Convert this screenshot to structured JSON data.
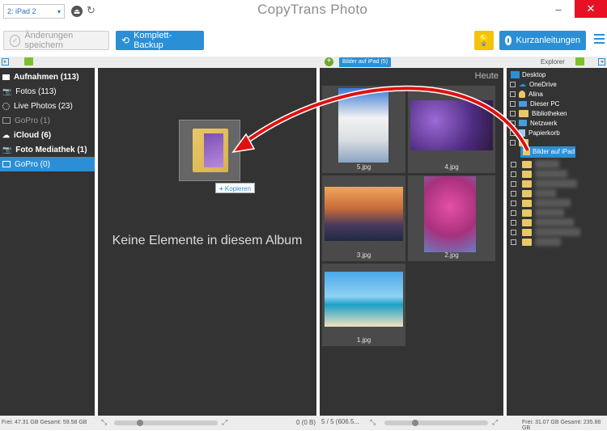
{
  "device": {
    "label": "2: iPad 2"
  },
  "app": {
    "title": "CopyTrans Photo"
  },
  "window": {
    "minimize": "–",
    "close": "✕"
  },
  "toolbar": {
    "save_label": "Änderungen speichern",
    "backup_label": "Komplett-Backup",
    "guides_label": "Kurzanleitungen"
  },
  "sidebar": {
    "items": [
      {
        "label": "Aufnahmen (113)",
        "icon": "folder-icon",
        "bold": true
      },
      {
        "label": "Fotos (113)",
        "icon": "camera-icon"
      },
      {
        "label": "Live Photos (23)",
        "icon": "live-photos-icon"
      },
      {
        "label": "GoPro (1)",
        "icon": "gopro-icon",
        "dim": true
      },
      {
        "label": "iCloud (6)",
        "icon": "cloud-icon",
        "bold": true
      },
      {
        "label": "Foto Mediathek (1)",
        "icon": "camera-icon",
        "bold": true
      },
      {
        "label": "GoPro (0)",
        "icon": "gopro-icon",
        "selected": true
      }
    ]
  },
  "album": {
    "empty_text": "Keine Elemente in diesem Album",
    "drag_tooltip": "Kopieren"
  },
  "pc": {
    "tab_label": "Bilder auf iPad (5)",
    "group_header": "Heute",
    "photos": [
      {
        "name": "5.jpg"
      },
      {
        "name": "4.jpg"
      },
      {
        "name": "3.jpg"
      },
      {
        "name": "2.jpg"
      },
      {
        "name": "1.jpg"
      }
    ]
  },
  "explorer": {
    "title": "Explorer",
    "tree": [
      {
        "label": "Desktop"
      },
      {
        "label": "OneDrive"
      },
      {
        "label": "Alina"
      },
      {
        "label": "Dieser PC"
      },
      {
        "label": "Bibliotheken"
      },
      {
        "label": "Netzwerk"
      },
      {
        "label": "Papierkorb"
      },
      {
        "label": "Bilder auf iPad",
        "selected": true
      }
    ]
  },
  "status": {
    "left_free": "Frei: 47.31 GB Gesamt: 59.58 GB",
    "album_count": "0 (0 B)",
    "pc_count": "5 / 5 (606.5...",
    "right_free": "Frei: 31.07 GB Gesamt: 235.88 GB"
  },
  "colors": {
    "accent": "#2b8fd6",
    "panel": "#333333",
    "arrow": "#e01010"
  }
}
